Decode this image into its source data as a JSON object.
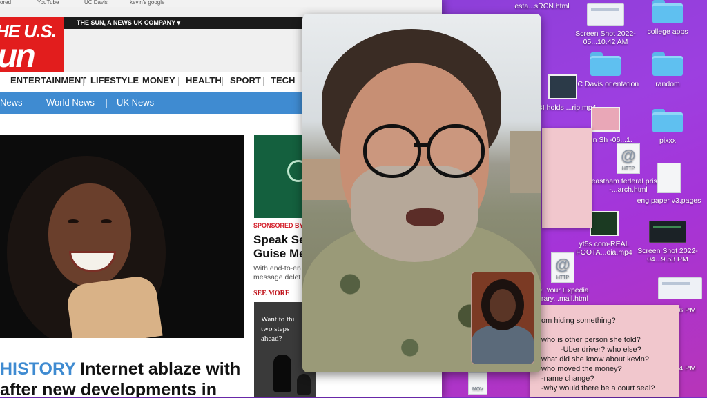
{
  "browser": {
    "bookmarks": [
      "ored",
      "YouTube",
      "UC Davis",
      "kevin's google"
    ],
    "logo_line1": "HE U.S.",
    "logo_line2": "un",
    "corp_label": "THE SUN, A NEWS UK COMPANY ▾",
    "nav": [
      "ENTERTAINMENT",
      "LIFESTYLE",
      "MONEY",
      "HEALTH",
      "SPORT",
      "TECH"
    ],
    "subnav": [
      "News",
      "World News",
      "UK News"
    ],
    "sponsored_label": "SPONSORED BY",
    "sponsored_title_1": "Speak Se",
    "sponsored_title_2": "Guise Me",
    "sponsored_desc_1": "With end-to-en",
    "sponsored_desc_2": "message delet",
    "see_more": "SEE MORE",
    "chess_text_1": "Want to thi",
    "chess_text_2": "two steps",
    "chess_text_3": "ahead?",
    "headline_kicker": "HISTORY",
    "headline_1": "Internet ablaze with",
    "headline_2": "after new developments in"
  },
  "desktop": {
    "icons": [
      {
        "label": "esta...sRCN.html"
      },
      {
        "label": "Screen Shot 2022-05...10.42 AM"
      },
      {
        "label": "college apps"
      },
      {
        "label": "UC Davis orientation"
      },
      {
        "label": "random"
      },
      {
        "label": ": FBI holds ...rip.mp4"
      },
      {
        "label": "creen Sh -06...1."
      },
      {
        "label": "pixxx"
      },
      {
        "label": "eastham federal prison -...arch.html"
      },
      {
        "label": "eng paper v3.pages"
      },
      {
        "label": "yt5s.com-REAL FOOTA...oia.mp4"
      },
      {
        "label": "Screen Shot 2022-04...9.53 PM"
      },
      {
        "label": "D: Your Expedia erary...mail.html"
      },
      {
        "label": "hot 26 PM"
      },
      {
        "label": "hot 04 PM"
      },
      {
        "label": "MOV"
      }
    ],
    "note_lines": [
      "om hiding something?",
      "who is other person she told?",
      "-Uber driver? who else?",
      "what did she know about kevin?",
      "who moved the money?",
      "-name change?",
      "-why would there be a court seal?"
    ]
  },
  "call": {
    "remote_caller": "video-call-remote",
    "self_view": "video-call-self"
  }
}
